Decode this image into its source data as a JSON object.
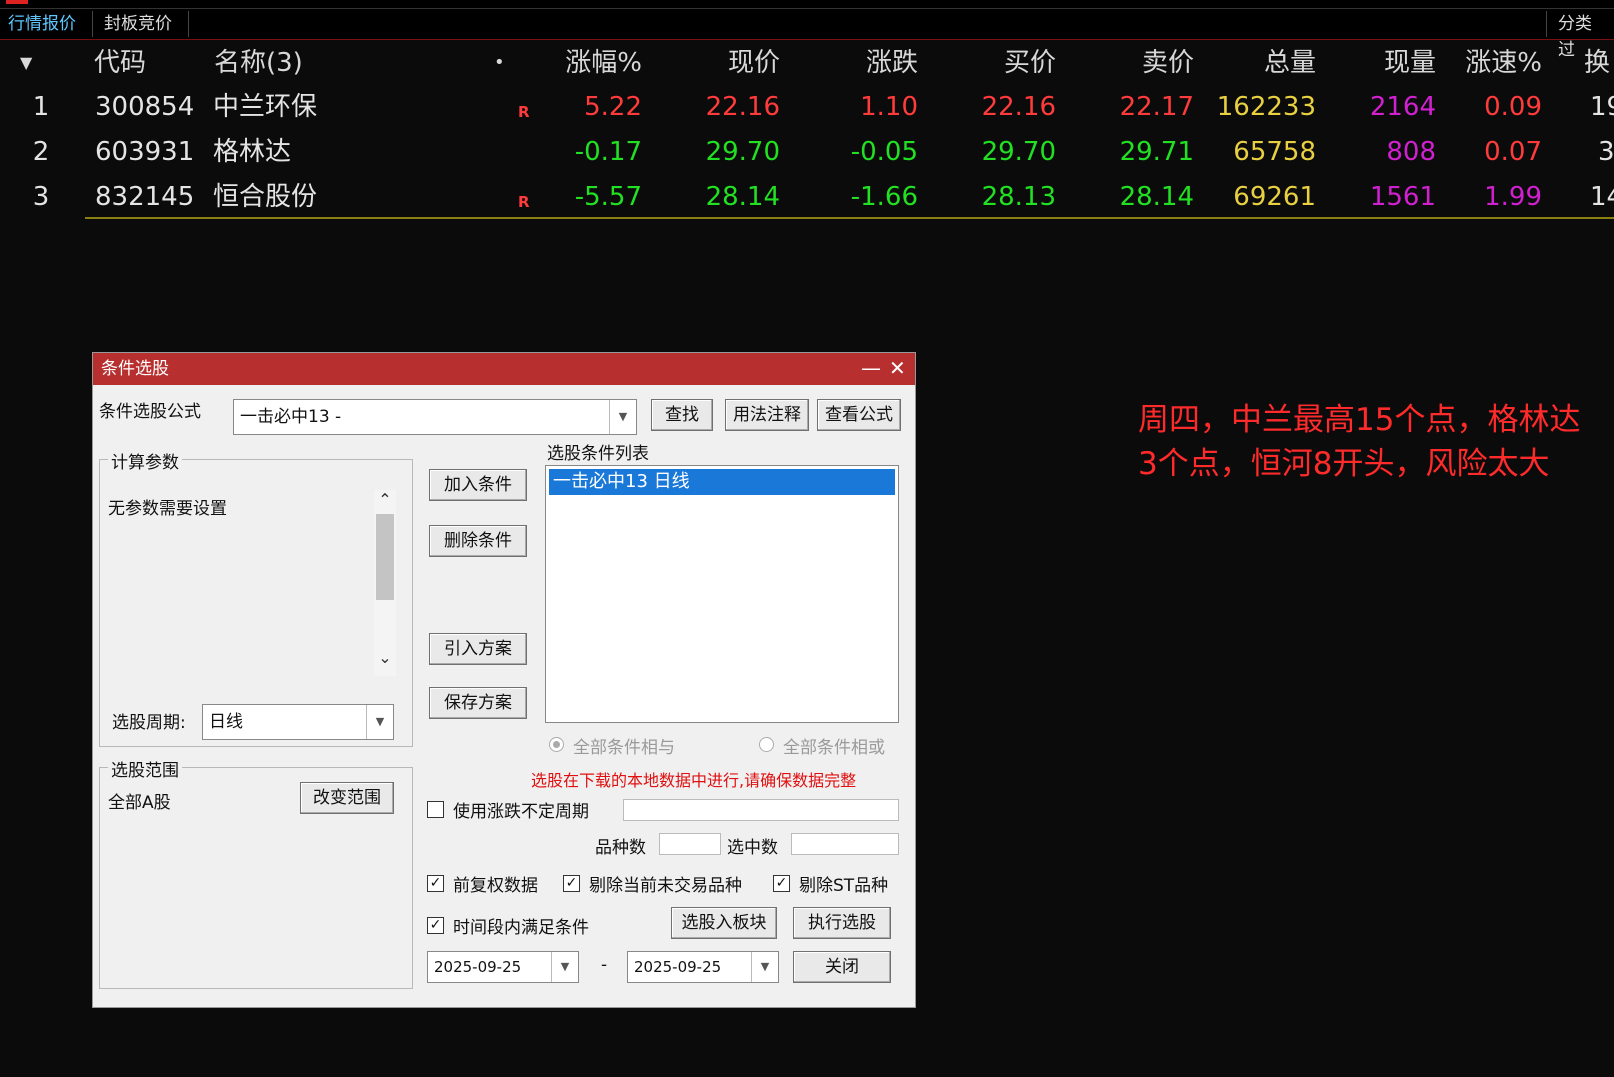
{
  "tabs": [
    {
      "label": "行情报价",
      "active": true
    },
    {
      "label": "封板竞价",
      "active": false
    }
  ],
  "tabs_right": "分类过",
  "columns": {
    "code": "代码",
    "name": "名称(3)",
    "dot": "•",
    "pct": "涨幅%",
    "price": "现价",
    "change": "涨跌",
    "bid": "买价",
    "ask": "卖价",
    "volume": "总量",
    "cur_vol": "现量",
    "speed": "涨速%",
    "turnover": "换"
  },
  "rows": [
    {
      "idx": "1",
      "code": "300854",
      "name": "中兰环保",
      "mark": "R",
      "pct": "5.22",
      "price": "22.16",
      "change": "1.10",
      "bid": "22.16",
      "ask": "22.17",
      "volume": "162233",
      "cur_vol": "2164",
      "speed": "0.09",
      "turnover": "19"
    },
    {
      "idx": "2",
      "code": "603931",
      "name": "格林达",
      "mark": "",
      "pct": "-0.17",
      "price": "29.70",
      "change": "-0.05",
      "bid": "29.70",
      "ask": "29.71",
      "volume": "65758",
      "cur_vol": "808",
      "speed": "0.07",
      "turnover": "3"
    },
    {
      "idx": "3",
      "code": "832145",
      "name": "恒合股份",
      "mark": "R",
      "pct": "-5.57",
      "price": "28.14",
      "change": "-1.66",
      "bid": "28.13",
      "ask": "28.14",
      "volume": "69261",
      "cur_vol": "1561",
      "speed": "1.99",
      "turnover": "14"
    }
  ],
  "annotation": {
    "line1": "周四，中兰最高15个点，格林达",
    "line2": "3个点，恒河8开头，风险太大"
  },
  "dialog": {
    "title": "条件选股",
    "formula_label": "条件选股公式",
    "formula_value": "一击必中13  -",
    "btn_find": "查找",
    "btn_usage": "用法注释",
    "btn_view": "查看公式",
    "params_group": "计算参数",
    "params_text": "无参数需要设置",
    "period_label": "选股周期:",
    "period_value": "日线",
    "range_group": "选股范围",
    "range_value": "全部A股",
    "btn_change_range": "改变范围",
    "btn_add": "加入条件",
    "btn_delete": "删除条件",
    "btn_import": "引入方案",
    "btn_save": "保存方案",
    "list_label": "选股条件列表",
    "list_items": [
      "一击必中13  日线"
    ],
    "radio_and": "全部条件相与",
    "radio_or": "全部条件相或",
    "warning": "选股在下载的本地数据中进行,请确保数据完整",
    "chk_uncertain_period": "使用涨跌不定周期",
    "variety_count_label": "品种数",
    "selected_count_label": "选中数",
    "chk_adjusted": "前复权数据",
    "chk_exclude_untraded": "剔除当前未交易品种",
    "chk_exclude_st": "剔除ST品种",
    "chk_timerange": "时间段内满足条件",
    "btn_to_block": "选股入板块",
    "btn_execute": "执行选股",
    "date_from": "2025-09-25",
    "date_sep": "-",
    "date_to": "2025-09-25",
    "btn_close": "关闭"
  },
  "colors": {
    "up": "#ff3b3b",
    "down": "#22e022",
    "volume": "#e8d040",
    "cur_vol": "#d020d0",
    "dialog_title": "#b7302f",
    "selection": "#1a78d8",
    "annotation": "#ff2a2a"
  }
}
